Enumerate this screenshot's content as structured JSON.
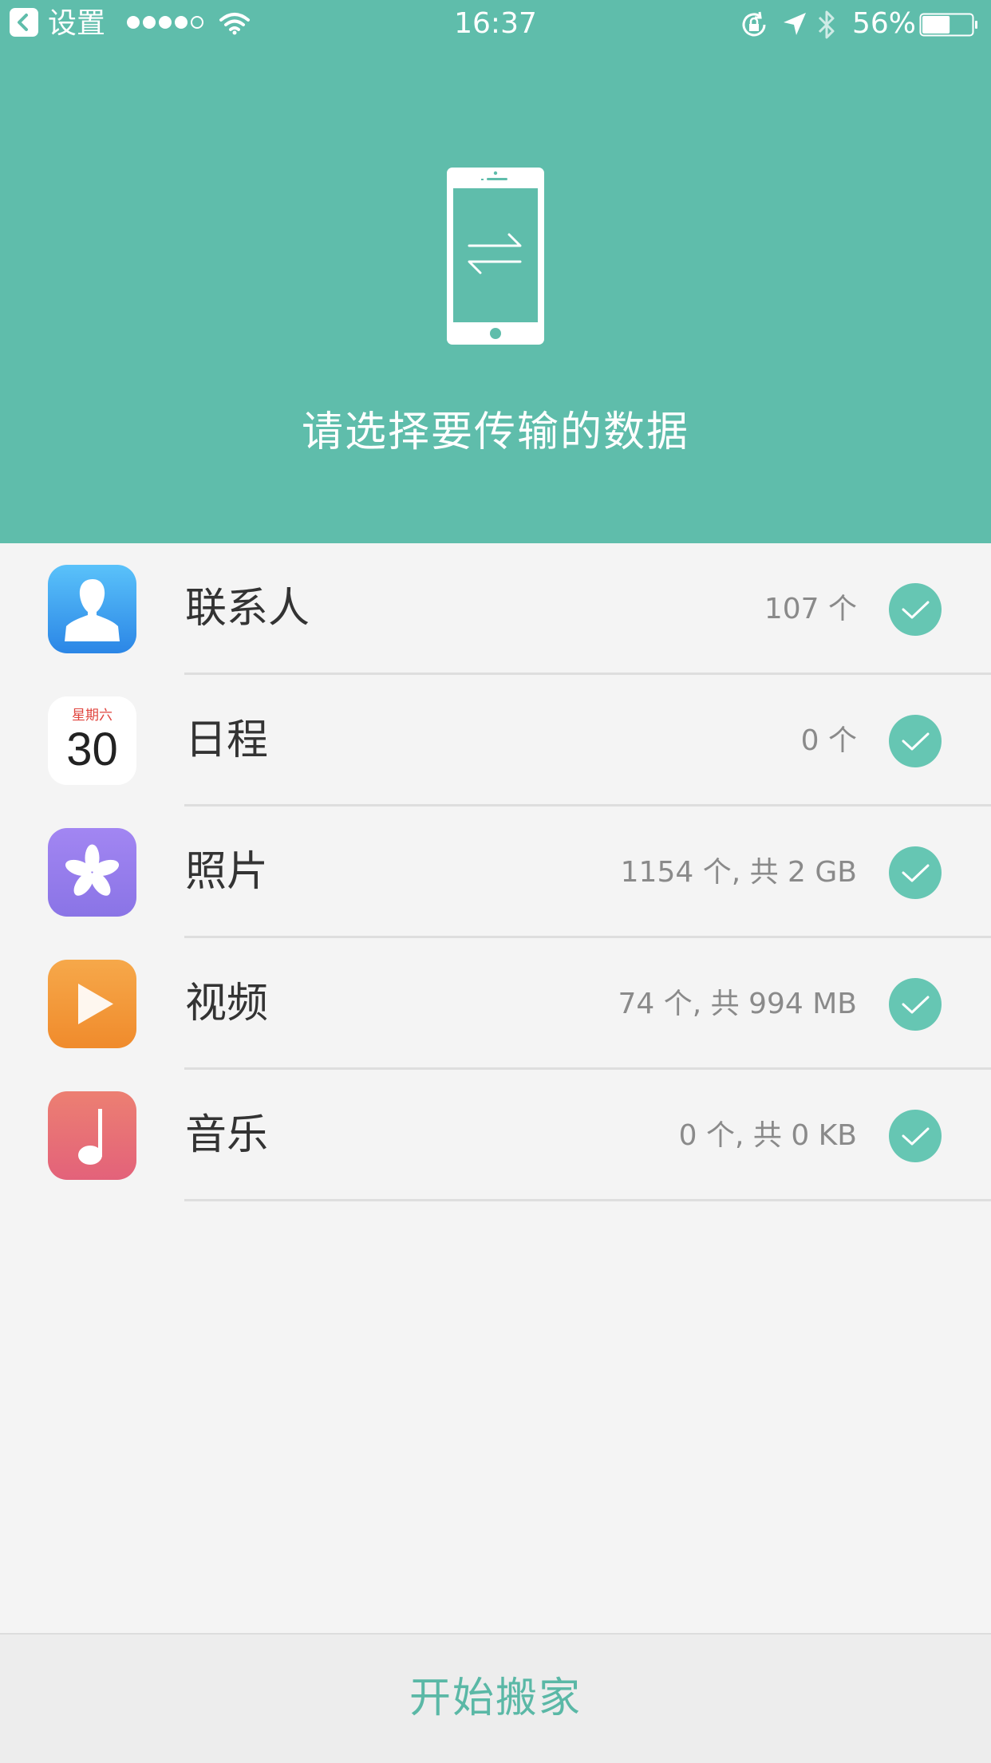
{
  "status_bar": {
    "back_label": "设置",
    "time": "16:37",
    "battery_percent": "56%",
    "battery_level": 0.56,
    "signal_bars": 4
  },
  "header": {
    "title": "请选择要传输的数据",
    "illustration": "phone-transfer-icon"
  },
  "items": [
    {
      "label": "联系人",
      "meta": "107 个",
      "checked": true,
      "icon": "contacts-icon"
    },
    {
      "label": "日程",
      "meta": "0 个",
      "checked": true,
      "icon": "calendar-icon",
      "calendar_day": "星期六",
      "calendar_date": "30"
    },
    {
      "label": "照片",
      "meta": "1154 个, 共 2 GB",
      "checked": true,
      "icon": "photos-icon"
    },
    {
      "label": "视频",
      "meta": "74 个, 共 994 MB",
      "checked": true,
      "icon": "videos-icon"
    },
    {
      "label": "音乐",
      "meta": "0 个, 共 0 KB",
      "checked": true,
      "icon": "music-icon"
    }
  ],
  "footer": {
    "start_label": "开始搬家"
  },
  "colors": {
    "header_bg": "#5fbdab",
    "accent": "#5ab8a6",
    "check": "#66c6b3"
  }
}
